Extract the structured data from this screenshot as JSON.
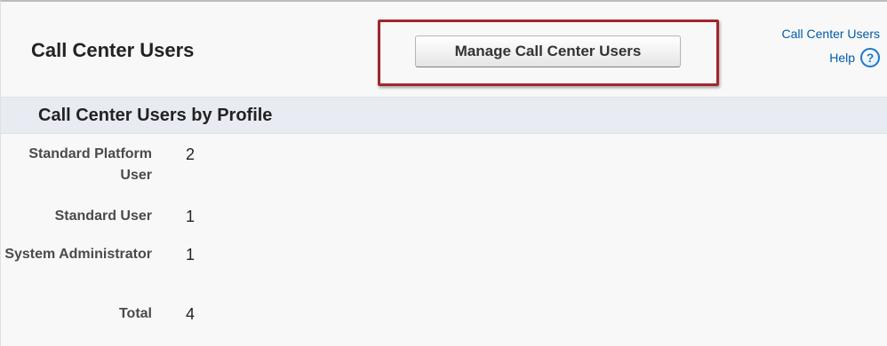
{
  "header": {
    "title": "Call Center Users",
    "manage_button_label": "Manage Call Center Users",
    "help_title": "Call Center Users",
    "help_label": "Help",
    "help_icon": "help-circle-icon",
    "help_icon_glyph": "?"
  },
  "section": {
    "title": "Call Center Users by Profile"
  },
  "profiles": [
    {
      "label": "Standard Platform User",
      "count": "2"
    },
    {
      "label": "Standard User",
      "count": "1"
    },
    {
      "label": "System Administrator",
      "count": "1"
    },
    {
      "label": "Total",
      "count": "4"
    }
  ],
  "colors": {
    "link": "#015ba7",
    "highlight_border": "#a3262b",
    "section_header_bg": "#e8ebf2",
    "page_bg": "#f8f8f8"
  }
}
